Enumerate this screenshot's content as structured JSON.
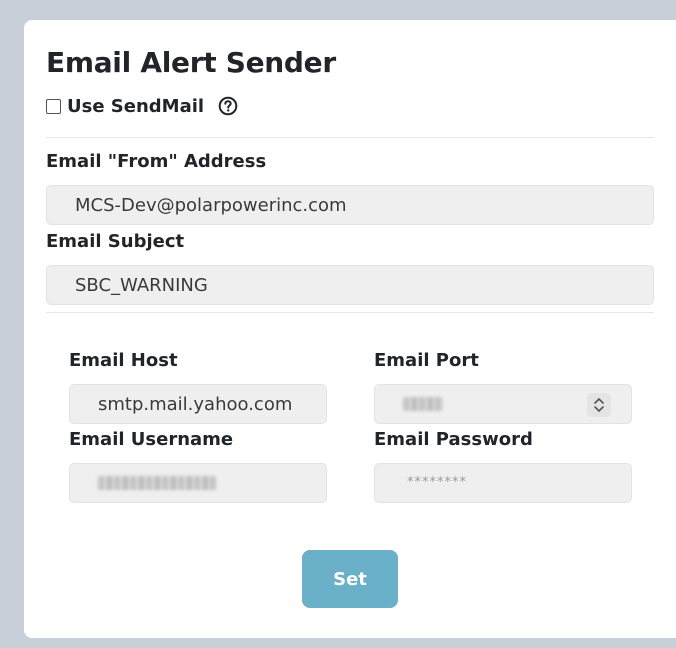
{
  "panel": {
    "title": "Email Alert Sender",
    "use_sendmail_label": "Use SendMail",
    "use_sendmail_checked": false
  },
  "fields": {
    "from_label": "Email \"From\" Address",
    "from_value": "MCS-Dev@polarpowerinc.com",
    "subject_label": "Email Subject",
    "subject_value": "SBC_WARNING",
    "host_label": "Email Host",
    "host_value": "smtp.mail.yahoo.com",
    "port_label": "Email Port",
    "username_label": "Email Username",
    "password_label": "Email Password",
    "password_mask": "********"
  },
  "actions": {
    "set_label": "Set"
  },
  "colors": {
    "button": "#6ab0c8",
    "input_bg": "#efefef",
    "page_bg": "#c9cfd8"
  },
  "icons": {
    "help": "question-circle-icon",
    "stepper": "up-down-chevron-icon"
  }
}
